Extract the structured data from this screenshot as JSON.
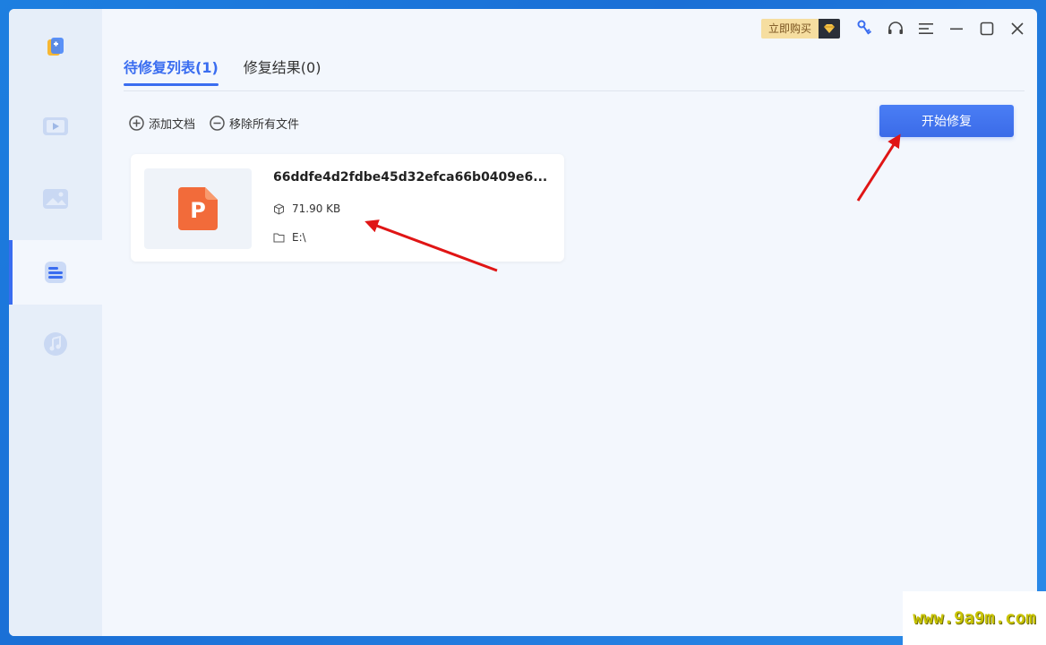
{
  "topbar": {
    "buy_label": "立即购买",
    "icons": [
      "gem-icon",
      "key-icon",
      "headset-icon",
      "menu-icon",
      "minimize-icon",
      "maximize-icon",
      "close-icon"
    ]
  },
  "sidebar": {
    "items": [
      {
        "name": "video",
        "icon": "film-icon"
      },
      {
        "name": "photo",
        "icon": "image-icon"
      },
      {
        "name": "document",
        "icon": "document-icon",
        "active": true
      },
      {
        "name": "audio",
        "icon": "music-icon"
      }
    ]
  },
  "tabs": [
    {
      "label": "待修复列表(1)",
      "active": true
    },
    {
      "label": "修复结果(0)",
      "active": false
    }
  ],
  "actions": {
    "add_label": "添加文档",
    "remove_label": "移除所有文件"
  },
  "start_button": "开始修复",
  "file": {
    "type_letter": "P",
    "name": "66ddfe4d2fdbe45d32efca66b0409e6...",
    "size": "71.90 KB",
    "path": "E:\\"
  },
  "watermark": "www.9a9m.com",
  "colors": {
    "accent": "#3a6df0",
    "ppt_orange": "#f26b3a",
    "annotation_red": "#e01515"
  }
}
